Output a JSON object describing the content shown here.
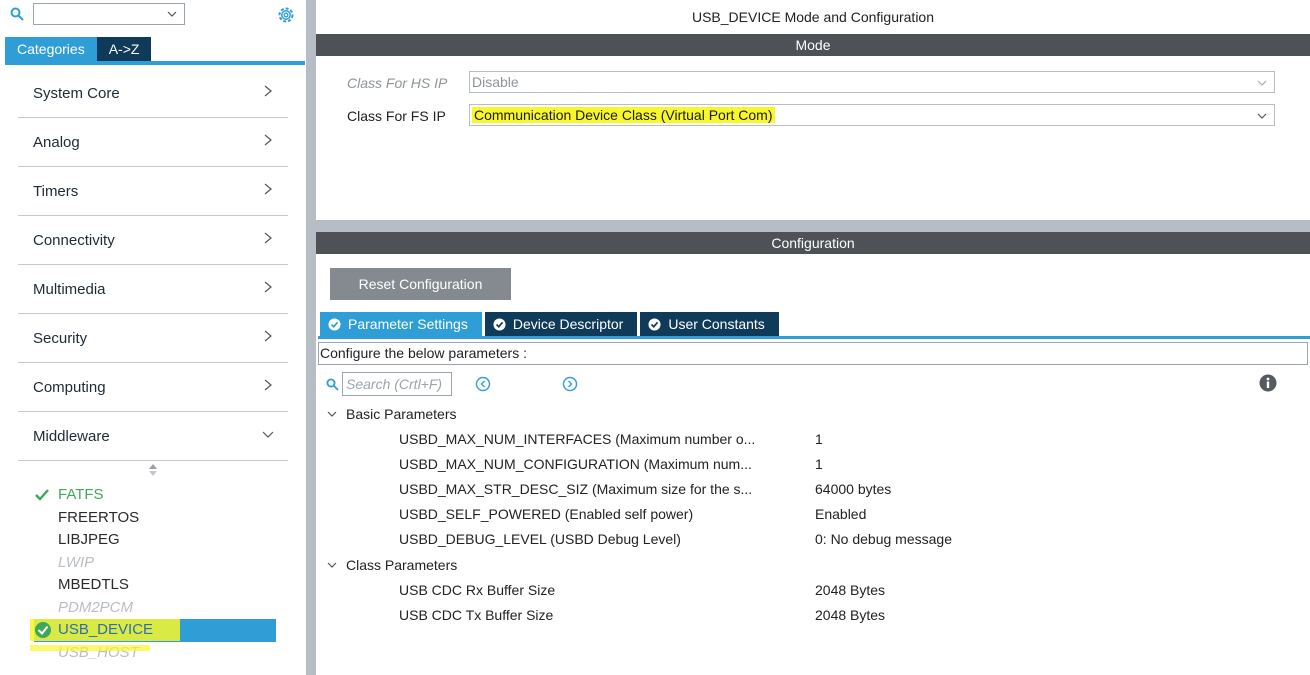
{
  "sidebar": {
    "search_value": "",
    "tabs": [
      {
        "label": "Categories",
        "active": true
      },
      {
        "label": "A->Z",
        "active": false
      }
    ],
    "categories": [
      {
        "label": "System Core",
        "expanded": false
      },
      {
        "label": "Analog",
        "expanded": false
      },
      {
        "label": "Timers",
        "expanded": false
      },
      {
        "label": "Connectivity",
        "expanded": false
      },
      {
        "label": "Multimedia",
        "expanded": false
      },
      {
        "label": "Security",
        "expanded": false
      },
      {
        "label": "Computing",
        "expanded": false
      },
      {
        "label": "Middleware",
        "expanded": true
      }
    ],
    "middleware_items": [
      {
        "label": "FATFS",
        "state": "ok"
      },
      {
        "label": "FREERTOS",
        "state": "enabled"
      },
      {
        "label": "LIBJPEG",
        "state": "enabled"
      },
      {
        "label": "LWIP",
        "state": "disabled"
      },
      {
        "label": "MBEDTLS",
        "state": "enabled"
      },
      {
        "label": "PDM2PCM",
        "state": "disabled"
      },
      {
        "label": "USB_DEVICE",
        "state": "selected"
      },
      {
        "label": "USB_HOST",
        "state": "disabled"
      }
    ]
  },
  "main": {
    "title": "USB_DEVICE Mode and Configuration",
    "mode_header": "Mode",
    "mode_rows": [
      {
        "label": "Class For HS IP",
        "value": "Disable",
        "disabled": true
      },
      {
        "label": "Class For FS IP",
        "value": "Communication Device Class (Virtual Port Com)",
        "disabled": false
      }
    ],
    "config_header": "Configuration",
    "reset_label": "Reset Configuration",
    "tabs": [
      {
        "label": "Parameter Settings",
        "active": true
      },
      {
        "label": "Device Descriptor",
        "active": false
      },
      {
        "label": "User Constants",
        "active": false
      }
    ],
    "note": "Configure the below parameters :",
    "search_placeholder": "Search (Crtl+F)",
    "groups": [
      {
        "label": "Basic Parameters",
        "params": [
          {
            "name": "USBD_MAX_NUM_INTERFACES (Maximum number o...",
            "value": "1"
          },
          {
            "name": "USBD_MAX_NUM_CONFIGURATION (Maximum num...",
            "value": "1"
          },
          {
            "name": "USBD_MAX_STR_DESC_SIZ (Maximum size for the s...",
            "value": "64000 bytes"
          },
          {
            "name": "USBD_SELF_POWERED (Enabled self power)",
            "value": "Enabled"
          },
          {
            "name": "USBD_DEBUG_LEVEL (USBD Debug Level)",
            "value": "0: No debug message"
          }
        ]
      },
      {
        "label": "Class Parameters",
        "params": [
          {
            "name": "USB CDC Rx Buffer Size",
            "value": "2048 Bytes"
          },
          {
            "name": "USB CDC Tx Buffer Size",
            "value": "2048 Bytes"
          }
        ]
      }
    ]
  },
  "colors": {
    "accent": "#2f9ed6",
    "dark_tab": "#0f3a5a",
    "header": "#4e5257",
    "highlight": "#f7f72c",
    "ok_green": "#3fa65a"
  }
}
